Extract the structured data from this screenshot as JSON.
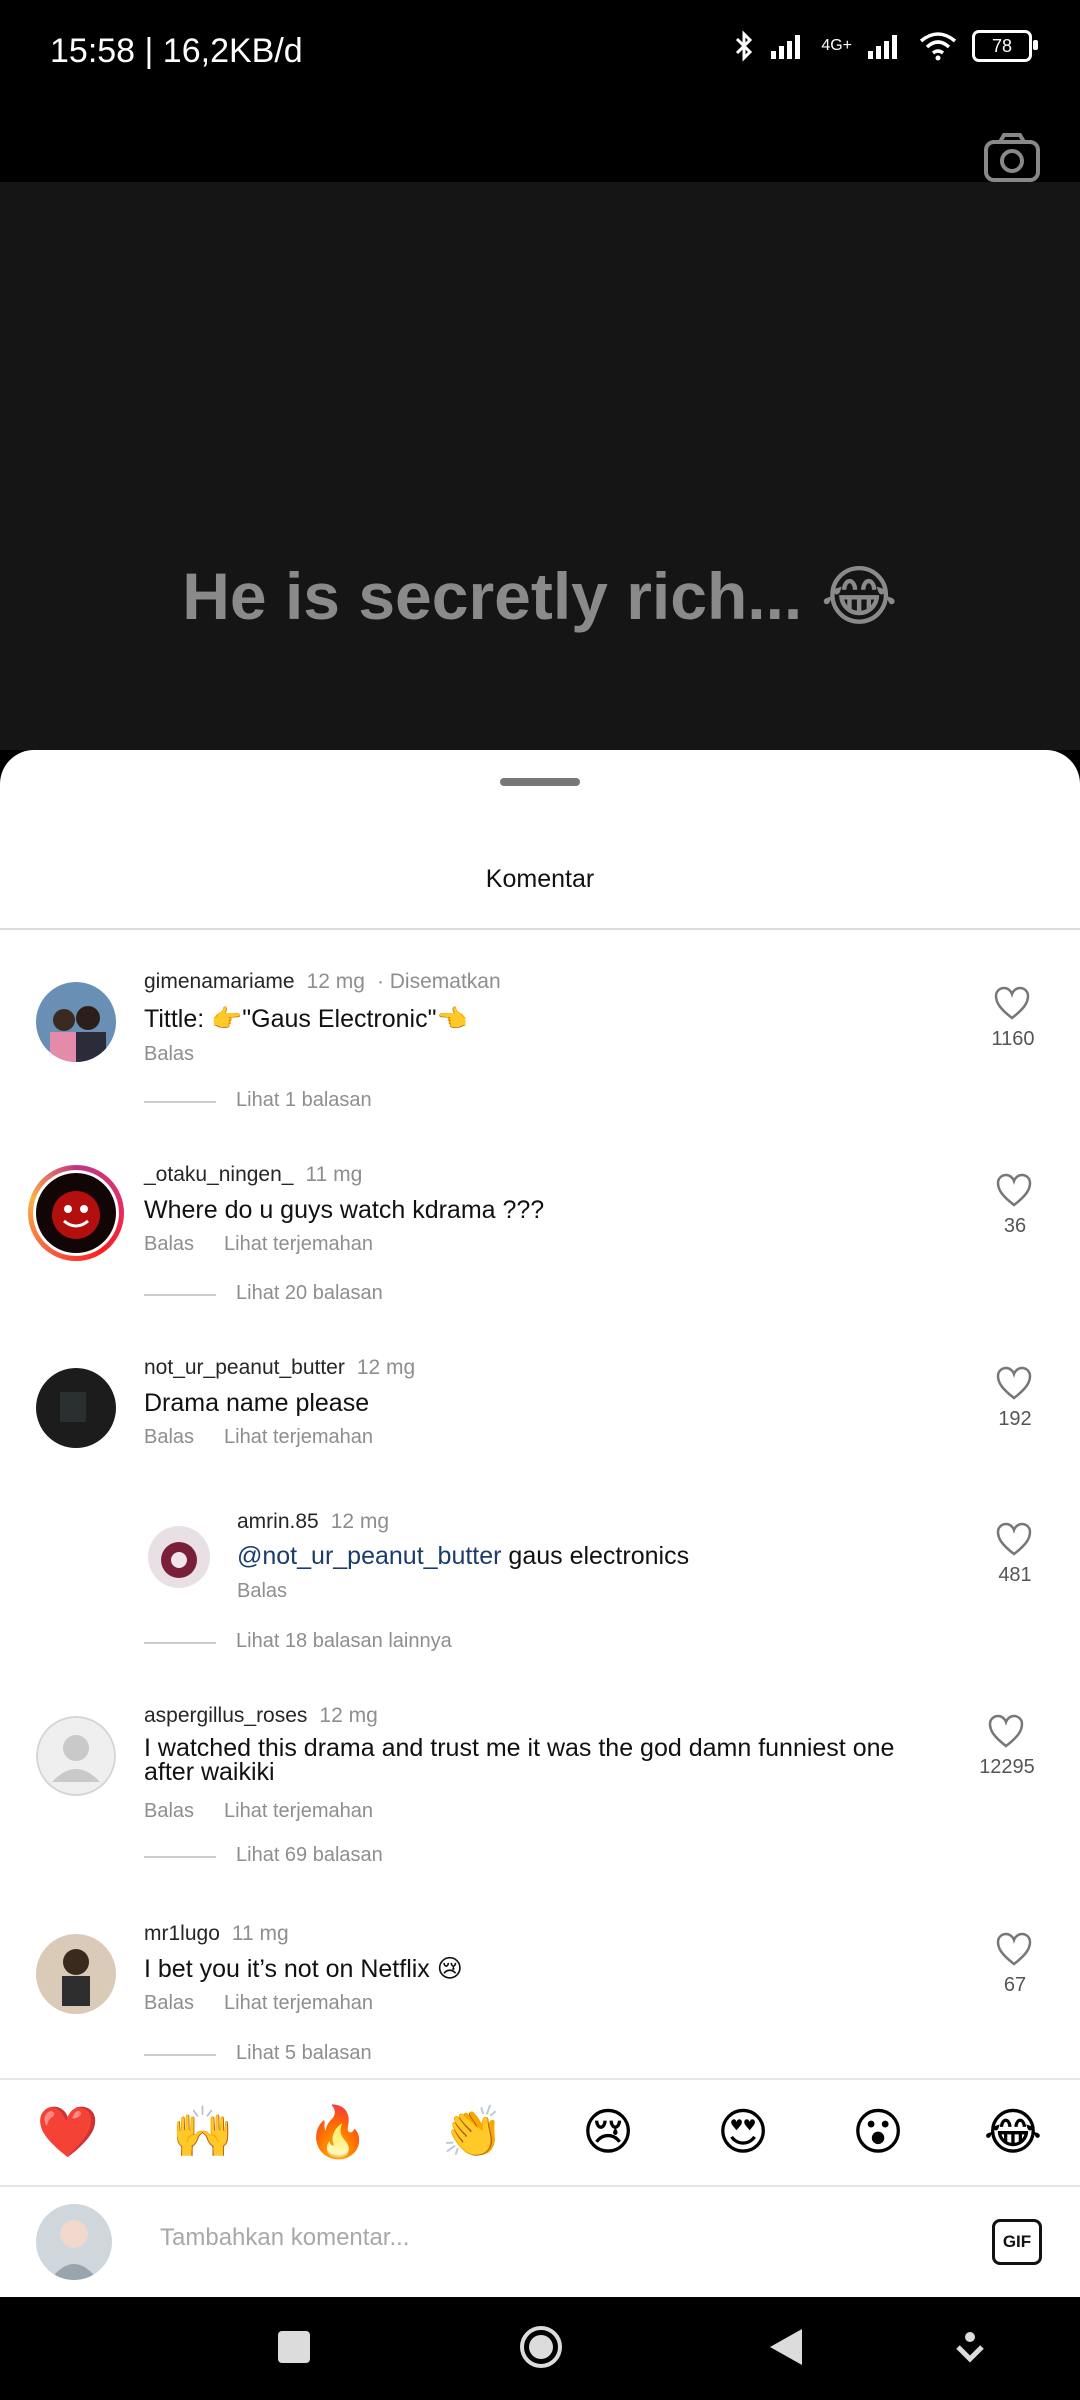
{
  "status": {
    "time": "15:58 | 16,2KB/d",
    "network": "4G+",
    "battery": "78"
  },
  "video": {
    "caption": "He is secretly rich... 😂"
  },
  "sheet": {
    "title": "Komentar"
  },
  "comments": [
    {
      "username": "gimenamariame",
      "time": "12 mg",
      "pinned": "· Disematkan",
      "text": "Tittle: 👉\"Gaus Electronic\"👈",
      "reply": "Balas",
      "translate": "",
      "likes": "1160",
      "view_replies": "Lihat 1 balasan"
    },
    {
      "username": "_otaku_ningen_",
      "time": "11 mg",
      "text": "Where do u guys watch kdrama ???",
      "reply": "Balas",
      "translate": "Lihat terjemahan",
      "likes": "36",
      "view_replies": "Lihat 20 balasan"
    },
    {
      "username": "not_ur_peanut_butter",
      "time": "12 mg",
      "text": "Drama name please",
      "reply": "Balas",
      "translate": "Lihat terjemahan",
      "likes": "192",
      "view_replies": "Lihat 18 balasan lainnya"
    },
    {
      "username": "aspergillus_roses",
      "time": "12 mg",
      "text": "I watched this drama and trust me it was the god damn funniest one after waikiki",
      "reply": "Balas",
      "translate": "Lihat terjemahan",
      "likes": "12295",
      "view_replies": "Lihat 69 balasan"
    },
    {
      "username": "mr1lugo",
      "time": "11 mg",
      "text": "I bet you it’s not on Netflix 😢",
      "reply": "Balas",
      "translate": "Lihat terjemahan",
      "likes": "67",
      "view_replies": "Lihat 5 balasan"
    }
  ],
  "nested_reply": {
    "username": "amrin.85",
    "time": "12 mg",
    "mention": "@not_ur_peanut_butter",
    "text": " gaus electronics",
    "reply": "Balas",
    "likes": "481"
  },
  "emoji_bar": [
    "❤️",
    "🙌",
    "🔥",
    "👏",
    "😢",
    "😍",
    "😮",
    "😂"
  ],
  "input": {
    "placeholder": "Tambahkan komentar...",
    "gif_label": "GIF"
  },
  "icons": {
    "camera": "camera-icon",
    "heart": "heart-outline-icon",
    "nav": [
      "square-icon",
      "circle-home-icon",
      "back-triangle-icon",
      "down-arrow-icon"
    ]
  }
}
